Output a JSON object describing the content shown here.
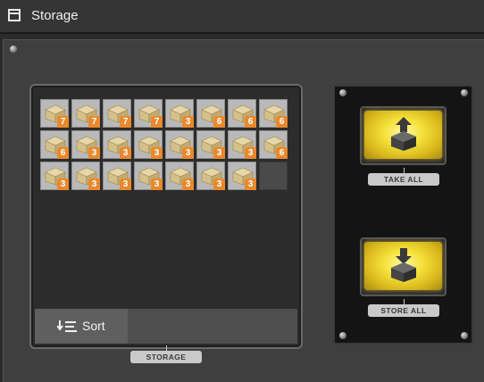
{
  "window": {
    "title": "Storage"
  },
  "storage": {
    "label": "STORAGE",
    "sort_label": "Sort",
    "slots": [
      {
        "count": "7"
      },
      {
        "count": "7"
      },
      {
        "count": "7"
      },
      {
        "count": "7"
      },
      {
        "count": "3"
      },
      {
        "count": "6"
      },
      {
        "count": "6"
      },
      {
        "count": "6"
      },
      {
        "count": "6"
      },
      {
        "count": "3"
      },
      {
        "count": "3"
      },
      {
        "count": "3"
      },
      {
        "count": "3"
      },
      {
        "count": "3"
      },
      {
        "count": "3"
      },
      {
        "count": "6"
      },
      {
        "count": "3"
      },
      {
        "count": "3"
      },
      {
        "count": "3"
      },
      {
        "count": "3"
      },
      {
        "count": "3"
      },
      {
        "count": "3"
      },
      {
        "count": "3"
      },
      {
        "count": null
      }
    ]
  },
  "actions": {
    "take_all_label": "TAKE ALL",
    "store_all_label": "STORE ALL"
  },
  "colors": {
    "badge": "#e8892e",
    "button_glow": "#f5e23a"
  },
  "icons": [
    "window-icon",
    "sort-icon",
    "crate-icon",
    "take-all-icon",
    "store-all-icon"
  ]
}
